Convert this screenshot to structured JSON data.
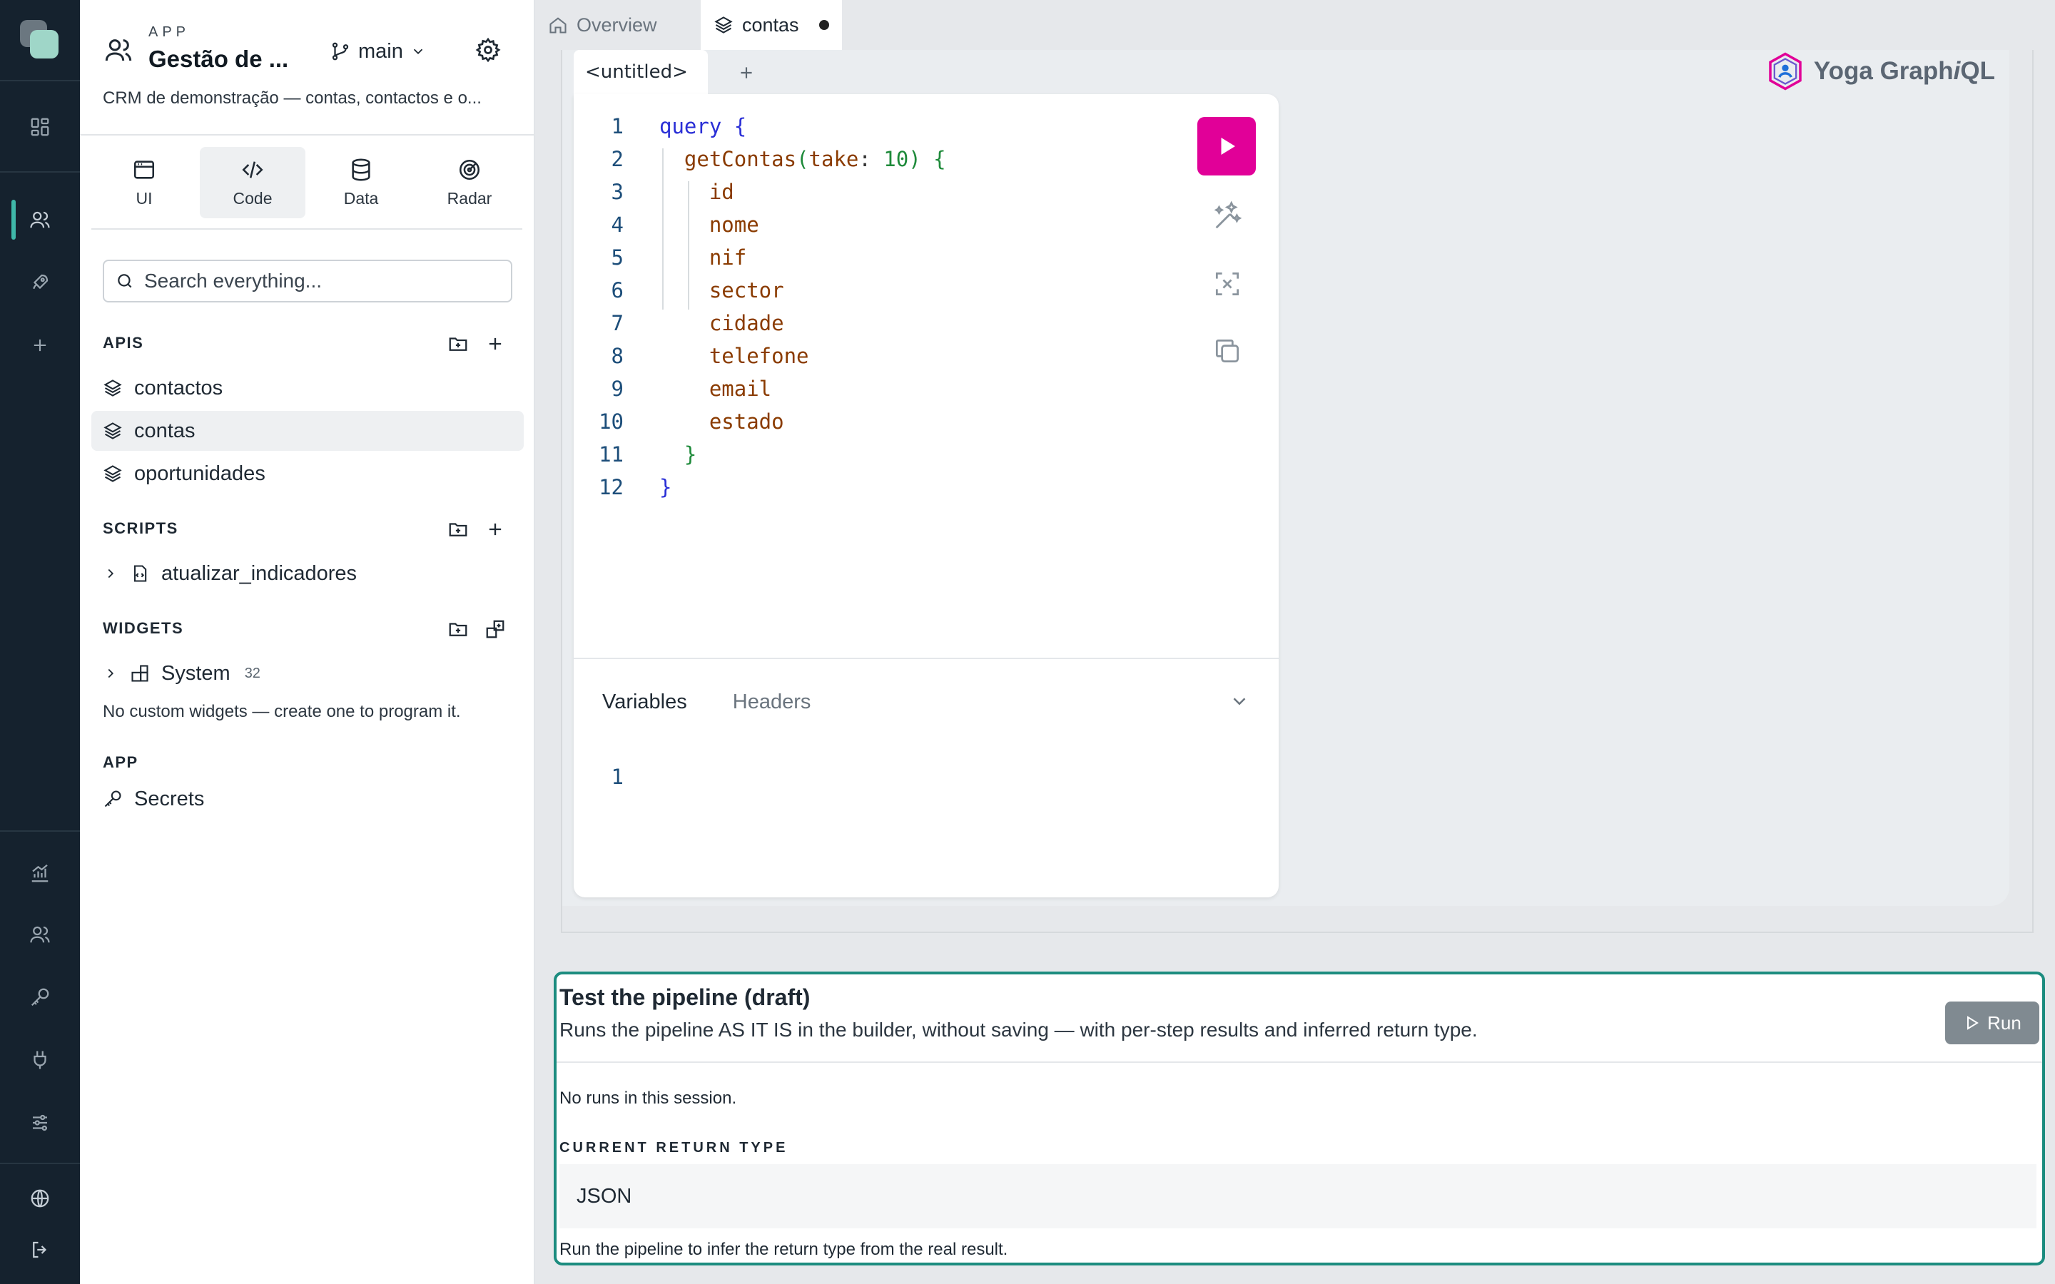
{
  "rail": {
    "items": [
      "dashboard-icon",
      "users-icon",
      "rocket-icon",
      "plus-icon",
      "chart-icon",
      "team-icon",
      "key-icon",
      "plug-icon",
      "sliders-icon",
      "globe-icon",
      "logout-icon"
    ]
  },
  "sidebar": {
    "app_label": "APP",
    "app_title": "Gestão de ...",
    "branch": "main",
    "description": "CRM de demonstração — contas, contactos e o...",
    "modes": [
      {
        "label": "UI",
        "icon": "window-icon"
      },
      {
        "label": "Code",
        "icon": "code-icon"
      },
      {
        "label": "Data",
        "icon": "database-icon"
      },
      {
        "label": "Radar",
        "icon": "radar-icon"
      }
    ],
    "active_mode": "Code",
    "search_placeholder": "Search everything...",
    "apis_title": "APIS",
    "apis": [
      "contactos",
      "contas",
      "oportunidades"
    ],
    "selected_api": "contas",
    "scripts_title": "SCRIPTS",
    "scripts": [
      "atualizar_indicadores"
    ],
    "widgets_title": "WIDGETS",
    "widgets_group": "System",
    "widgets_count": "32",
    "widgets_note": "No custom widgets — create one to program it.",
    "app_section_title": "APP",
    "app_items": [
      "Secrets"
    ]
  },
  "tabs": {
    "overview": "Overview",
    "contas": "contas"
  },
  "graphiql": {
    "tab_label": "<untitled>",
    "logo_text": "Yoga Graph",
    "logo_italic": "i",
    "logo_suffix": "QL",
    "line_numbers": [
      "1",
      "2",
      "3",
      "4",
      "5",
      "6",
      "7",
      "8",
      "9",
      "10",
      "11",
      "12"
    ],
    "query_keyword": "query",
    "operation": "getContas",
    "arg_name": "take",
    "arg_value": "10",
    "fields": [
      "id",
      "nome",
      "nif",
      "sector",
      "cidade",
      "telefone",
      "email",
      "estado"
    ],
    "variables_tab": "Variables",
    "headers_tab": "Headers",
    "variables_line": "1"
  },
  "test_panel": {
    "title": "Test the pipeline (draft)",
    "description": "Runs the pipeline AS IT IS in the builder, without saving — with per-step results and inferred return type.",
    "run_label": "Run",
    "no_runs": "No runs in this session.",
    "return_type_label": "CURRENT RETURN TYPE",
    "return_type": "JSON",
    "hint": "Run the pipeline to infer the return type from the real result."
  },
  "colors": {
    "rail_bg": "#15222e",
    "accent": "#3fb8a9",
    "run_button": "#e10098",
    "panel_border": "#1c8c7f"
  }
}
